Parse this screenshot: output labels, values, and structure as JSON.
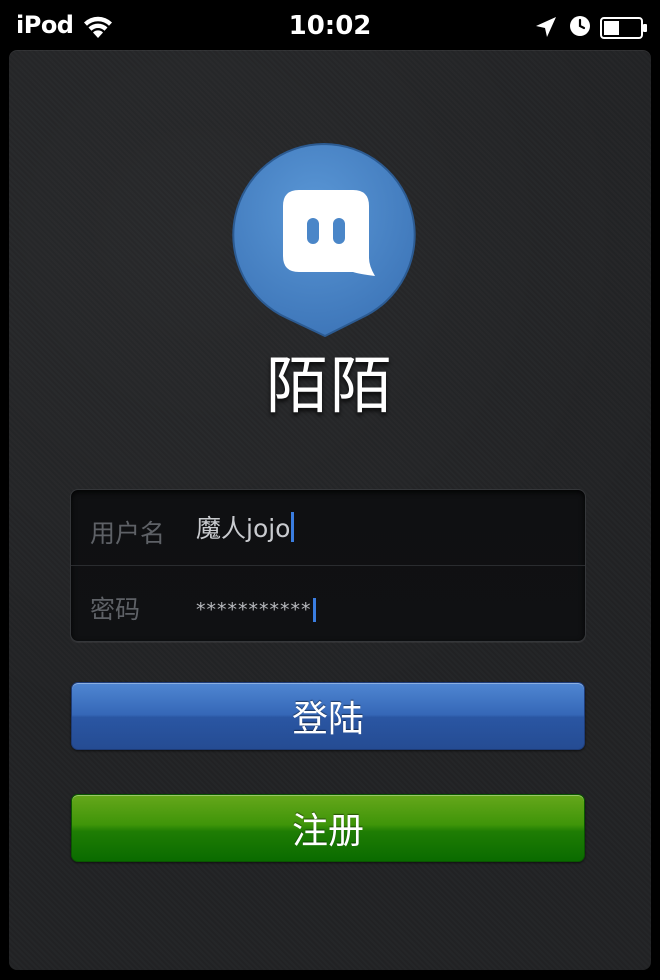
{
  "status_bar": {
    "carrier": "iPod",
    "time": "10:02",
    "icons": [
      "wifi-icon",
      "location-arrow-icon",
      "alarm-clock-icon",
      "battery-icon"
    ]
  },
  "app": {
    "name": "陌陌",
    "logo_icon": "chat-bubble-logo-icon",
    "brand_color": "#4a86c8"
  },
  "login_form": {
    "username": {
      "label": "用户名",
      "value": "魔人jojo"
    },
    "password": {
      "label": "密码",
      "value": "***********"
    }
  },
  "buttons": {
    "login_label": "登陆",
    "login_color": "#3567b7",
    "register_label": "注册",
    "register_color": "#1f7d04"
  }
}
